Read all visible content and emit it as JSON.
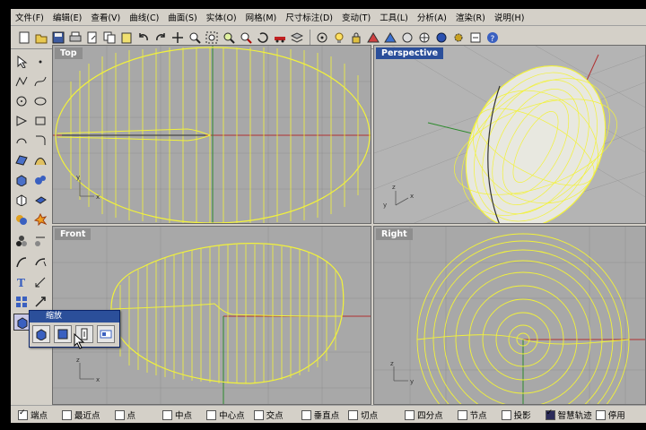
{
  "menu": [
    "文件(F)",
    "编辑(E)",
    "查看(V)",
    "曲线(C)",
    "曲面(S)",
    "实体(O)",
    "网格(M)",
    "尺寸标注(D)",
    "变动(T)",
    "工具(L)",
    "分析(A)",
    "渲染(R)",
    "说明(H)"
  ],
  "toolbar_icons": [
    "new-file-icon",
    "open-icon",
    "save-icon",
    "print-icon",
    "import-icon",
    "copy-icon",
    "paste-icon",
    "undo-icon",
    "redo-icon",
    "pan-icon",
    "zoom-icon",
    "zoom-window-icon",
    "zoom-extents-icon",
    "zoom-selected-icon",
    "rotate-view-icon",
    "car-icon",
    "layer-icon",
    "point-on-icon",
    "light-icon",
    "lock-icon",
    "render-icon",
    "sphere-icon",
    "mesh-icon",
    "ball-icon",
    "gear-icon",
    "options-icon",
    "help-icon"
  ],
  "viewports": {
    "top": {
      "label": "Top"
    },
    "perspective": {
      "label": "Perspective"
    },
    "front": {
      "label": "Front"
    },
    "right": {
      "label": "Right"
    }
  },
  "popup": {
    "title": "缩放"
  },
  "osnaps": [
    {
      "label": "端点",
      "checked": true
    },
    {
      "label": "最近点",
      "checked": false
    },
    {
      "label": "点",
      "checked": false
    },
    {
      "label": "中点",
      "checked": false
    },
    {
      "label": "中心点",
      "checked": false
    },
    {
      "label": "交点",
      "checked": false
    },
    {
      "label": "垂直点",
      "checked": false
    },
    {
      "label": "切点",
      "checked": false
    },
    {
      "label": "四分点",
      "checked": false
    },
    {
      "label": "节点",
      "checked": false
    },
    {
      "label": "投影",
      "checked": false
    },
    {
      "label": "智慧轨迹",
      "checked": true
    },
    {
      "label": "停用",
      "checked": false
    }
  ],
  "colors": {
    "wire": "#f2f23a",
    "x_axis": "#b03030",
    "y_axis": "#2c8a2c",
    "active_label": "#2b4f9a"
  }
}
